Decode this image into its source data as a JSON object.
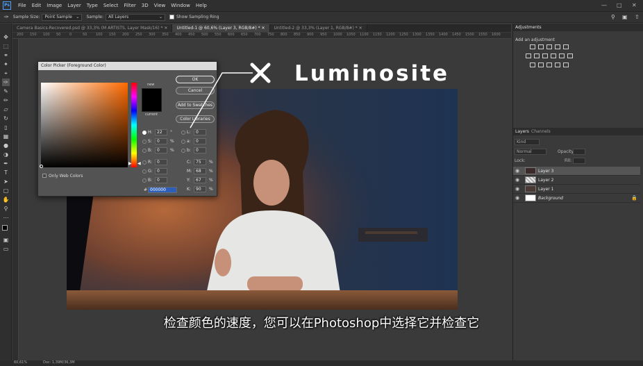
{
  "menu": {
    "logo": "Ps",
    "items": [
      "File",
      "Edit",
      "Image",
      "Layer",
      "Type",
      "Select",
      "Filter",
      "3D",
      "View",
      "Window",
      "Help"
    ]
  },
  "options_bar": {
    "sample_size_label": "Sample Size:",
    "sample_size_value": "Point Sample",
    "sample_label": "Sample:",
    "sample_value": "All Layers",
    "show_ring_label": "Show Sampling Ring"
  },
  "tabs": [
    {
      "label": "Camera Basics-Recovered.psd @ 33,3% (M ARTISTS, Layer Mask/16) *",
      "active": false
    },
    {
      "label": "Untitled-1 @ 60,6% (Layer 3, RGB/8#) *",
      "active": true
    },
    {
      "label": "Untitled-2 @ 33,3% (Layer 1, RGB/8#) *",
      "active": false
    }
  ],
  "ruler_ticks": [
    "200",
    "150",
    "100",
    "50",
    "0",
    "50",
    "100",
    "150",
    "200",
    "250",
    "300",
    "350",
    "400",
    "450",
    "500",
    "550",
    "600",
    "650",
    "700",
    "750",
    "800",
    "850",
    "900",
    "950",
    "1000",
    "1050",
    "1100",
    "1150",
    "1200",
    "1250",
    "1300",
    "1350",
    "1400",
    "1450",
    "1500",
    "1550",
    "1600"
  ],
  "color_picker": {
    "title": "Color Picker (Foreground Color)",
    "new_label": "new",
    "current_label": "current",
    "ok": "OK",
    "cancel": "Cancel",
    "add_swatches": "Add to Swatches",
    "color_libraries": "Color Libraries",
    "only_web_colors": "Only Web Colors",
    "H": {
      "label": "H:",
      "value": "22",
      "unit": "°"
    },
    "S": {
      "label": "S:",
      "value": "0",
      "unit": "%"
    },
    "B": {
      "label": "B:",
      "value": "0",
      "unit": "%"
    },
    "R": {
      "label": "R:",
      "value": "0"
    },
    "G": {
      "label": "G:",
      "value": "0"
    },
    "Bc": {
      "label": "B:",
      "value": "0"
    },
    "L": {
      "label": "L:",
      "value": "0"
    },
    "a": {
      "label": "a:",
      "value": "0"
    },
    "b": {
      "label": "b:",
      "value": "0"
    },
    "C": {
      "label": "C:",
      "value": "75",
      "unit": "%"
    },
    "M": {
      "label": "M:",
      "value": "68",
      "unit": "%"
    },
    "Y": {
      "label": "Y:",
      "value": "67",
      "unit": "%"
    },
    "K": {
      "label": "K:",
      "value": "90",
      "unit": "%"
    },
    "hex_label": "#",
    "hex_value": "000000"
  },
  "adjustments": {
    "tab": "Adjustments",
    "heading": "Add an adjustment"
  },
  "layers": {
    "tab_layers": "Layers",
    "tab_channels": "Channels",
    "kind": "Kind",
    "blend": "Normal",
    "opacity_label": "Opacity:",
    "lock_label": "Lock:",
    "fill_label": "Fill:",
    "items": [
      {
        "name": "Layer 3",
        "selected": true
      },
      {
        "name": "Layer 2",
        "selected": false
      },
      {
        "name": "Layer 1",
        "selected": false
      },
      {
        "name": "Background",
        "selected": false
      }
    ]
  },
  "status": {
    "zoom": "60,61%",
    "doc": "Doc: 1,39M/36,3M"
  },
  "annotation": {
    "mark": "X",
    "word": "Luminosite"
  },
  "subtitle": "检查颜色的速度，您可以在Photoshop中选择它并检查它",
  "colors": {
    "accent": "#4fa3ff",
    "hue_orange": "#ff6a00"
  }
}
